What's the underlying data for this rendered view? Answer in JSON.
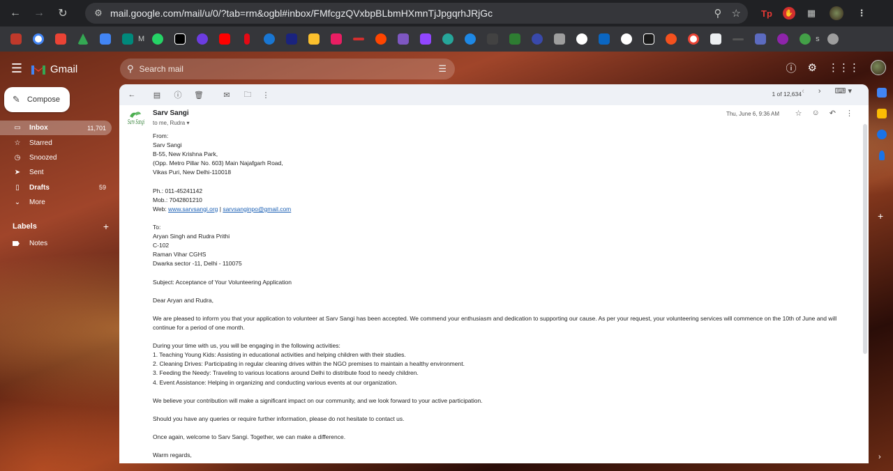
{
  "browser": {
    "url": "mail.google.com/mail/u/0/?tab=rm&ogbl#inbox/FMfcgzQVxbpBLbmHXmnTjJpgqrhJRjGc",
    "bookmark_text_1": "M",
    "bookmark_text_2": "s"
  },
  "gmail": {
    "logo_text": "Gmail",
    "search_placeholder": "Search mail",
    "compose_label": "Compose"
  },
  "nav": {
    "items": [
      {
        "label": "Inbox",
        "count": "11,701"
      },
      {
        "label": "Starred",
        "count": ""
      },
      {
        "label": "Snoozed",
        "count": ""
      },
      {
        "label": "Sent",
        "count": ""
      },
      {
        "label": "Drafts",
        "count": "59"
      },
      {
        "label": "More",
        "count": ""
      }
    ],
    "labels_heading": "Labels",
    "labels": [
      {
        "label": "Notes"
      }
    ]
  },
  "toolbar": {
    "pager": "1 of 12,634"
  },
  "message": {
    "sender": "Sarv Sangi",
    "to_line": "to me, Rudra",
    "date": "Thu, June 6, 9:36 AM",
    "logo_text": "Sarv Sangi"
  },
  "body": {
    "lines": [
      "From:",
      "Sarv Sangi",
      "B-55, New Krishna Park,",
      "(Opp. Metro Pillar No. 603) Main Najafgarh Road,",
      "Vikas Puri, New Delhi-110018",
      "",
      "Ph.: 011-45241142",
      "Mob.: 7042801210"
    ],
    "web_prefix": "Web: ",
    "web_link_1": "www.sarvsangi.org",
    "web_sep": " | ",
    "web_link_2": "sarvsanginpo@gmail.com",
    "lines_after": [
      "",
      "To:",
      "Aryan Singh and Rudra Prithi",
      "C-102",
      "Raman Vihar CGHS",
      "Dwarka sector -11, Delhi - 110075",
      "",
      "Subject: Acceptance of Your Volunteering Application",
      "",
      "Dear Aryan and Rudra,",
      "",
      "We are pleased to inform you that your application to volunteer at Sarv Sangi has been accepted. We commend your enthusiasm and dedication to supporting our cause. As per your request, your volunteering services will commence on the 10th of June and will continue for a period of one month.",
      "",
      "During your time with us, you will be engaging in the following activities:",
      "1. Teaching Young Kids: Assisting in educational activities and helping children with their studies.",
      "2. Cleaning Drives: Participating in regular cleaning drives within the NGO premises to maintain a healthy environment.",
      "3. Feeding the Needy: Traveling to various locations around Delhi to distribute food to needy children.",
      "4. Event Assistance: Helping in organizing and conducting various events at our organization.",
      "",
      "We believe your contribution will make a significant impact on our community, and we look forward to your active participation.",
      "",
      "Should you have any queries or require further information, please do not hesitate to contact us.",
      "",
      "Once again, welcome to Sarv Sangi. Together, we can make a difference.",
      "",
      "Warm regards,"
    ]
  }
}
